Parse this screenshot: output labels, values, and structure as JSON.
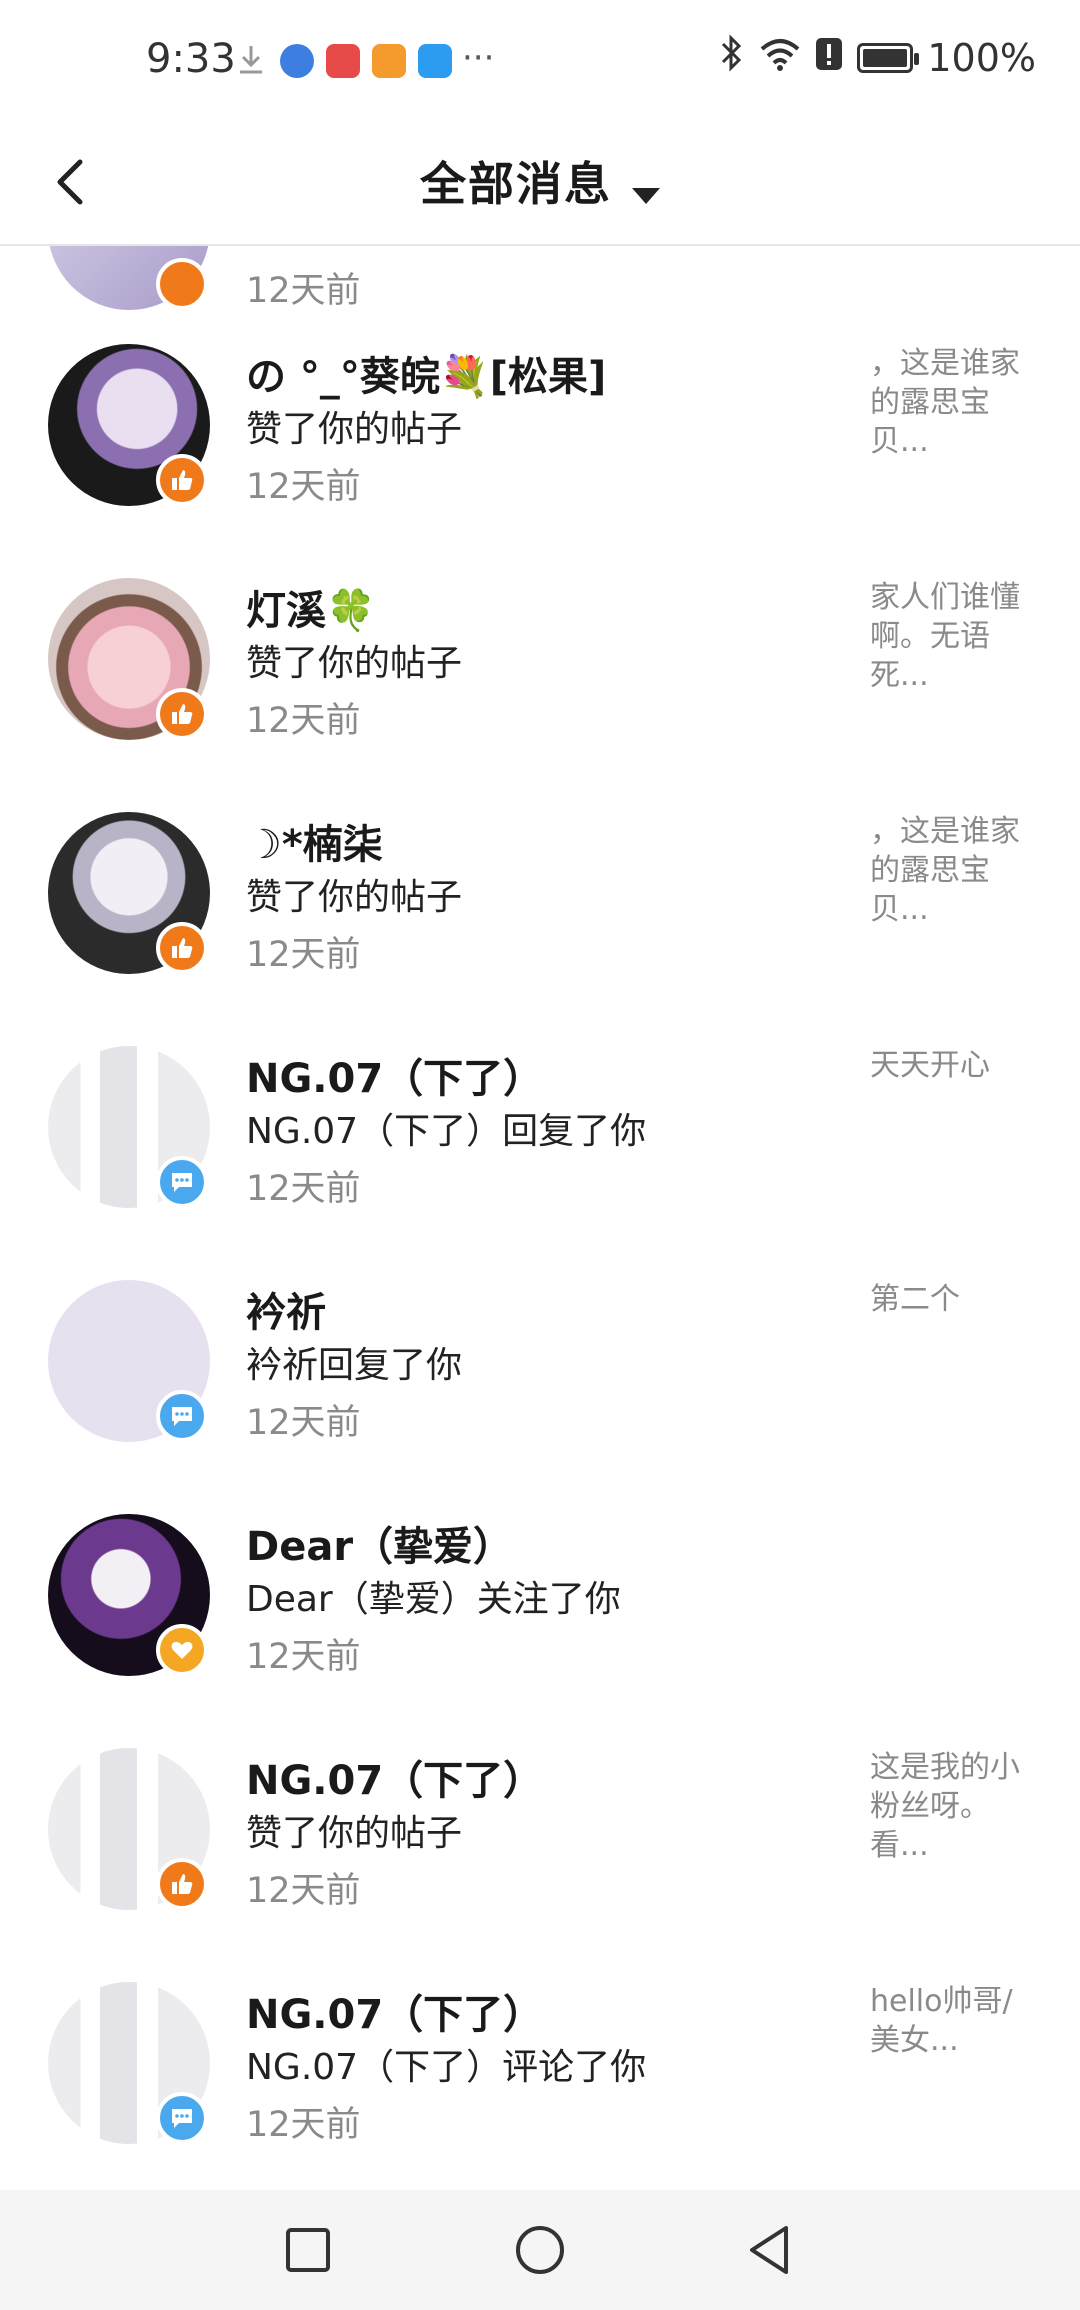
{
  "status_bar": {
    "time": "9:33",
    "overflow": "···",
    "battery": "100%",
    "icons": [
      "download-icon",
      "browser-icon",
      "reader-app-icon",
      "video-app-icon",
      "search-app-icon",
      "bluetooth-icon",
      "wifi-icon",
      "alert-icon",
      "battery-icon"
    ]
  },
  "header": {
    "title": "全部消息"
  },
  "partial_row": {
    "time": "12天前"
  },
  "messages": [
    {
      "name": "の °_°葵皖💐[松果]",
      "action": "赞了你的帖子",
      "time": "12天前",
      "snippet": "，这是谁家的露思宝贝...",
      "badge": "like"
    },
    {
      "name": "灯溪🍀",
      "action": "赞了你的帖子",
      "time": "12天前",
      "snippet": "家人们谁懂啊。无语死...",
      "badge": "like"
    },
    {
      "name": "☽*楠柒",
      "action": "赞了你的帖子",
      "time": "12天前",
      "snippet": "，这是谁家的露思宝贝...",
      "badge": "like"
    },
    {
      "name": "NG.07（下了）",
      "action": "NG.07（下了）回复了你",
      "time": "12天前",
      "snippet": "天天开心",
      "badge": "comment"
    },
    {
      "name": "衿祈",
      "action": "衿祈回复了你",
      "time": "12天前",
      "snippet": "第二个",
      "badge": "comment"
    },
    {
      "name": "Dear（挚爱）",
      "action": "Dear（挚爱）关注了你",
      "time": "12天前",
      "snippet": "",
      "badge": "follow"
    },
    {
      "name": "NG.07（下了）",
      "action": "赞了你的帖子",
      "time": "12天前",
      "snippet": "这是我的小粉丝呀。看...",
      "badge": "like"
    },
    {
      "name": "NG.07（下了）",
      "action": "NG.07（下了）评论了你",
      "time": "12天前",
      "snippet": "hello帅哥/美女...",
      "badge": "comment"
    }
  ],
  "colors": {
    "like_badge": "#f07a1a",
    "comment_badge": "#4aa8ef",
    "follow_badge": "#f5a623",
    "divider": "#e6e6e6",
    "secondary_text": "#8a8a8a"
  }
}
